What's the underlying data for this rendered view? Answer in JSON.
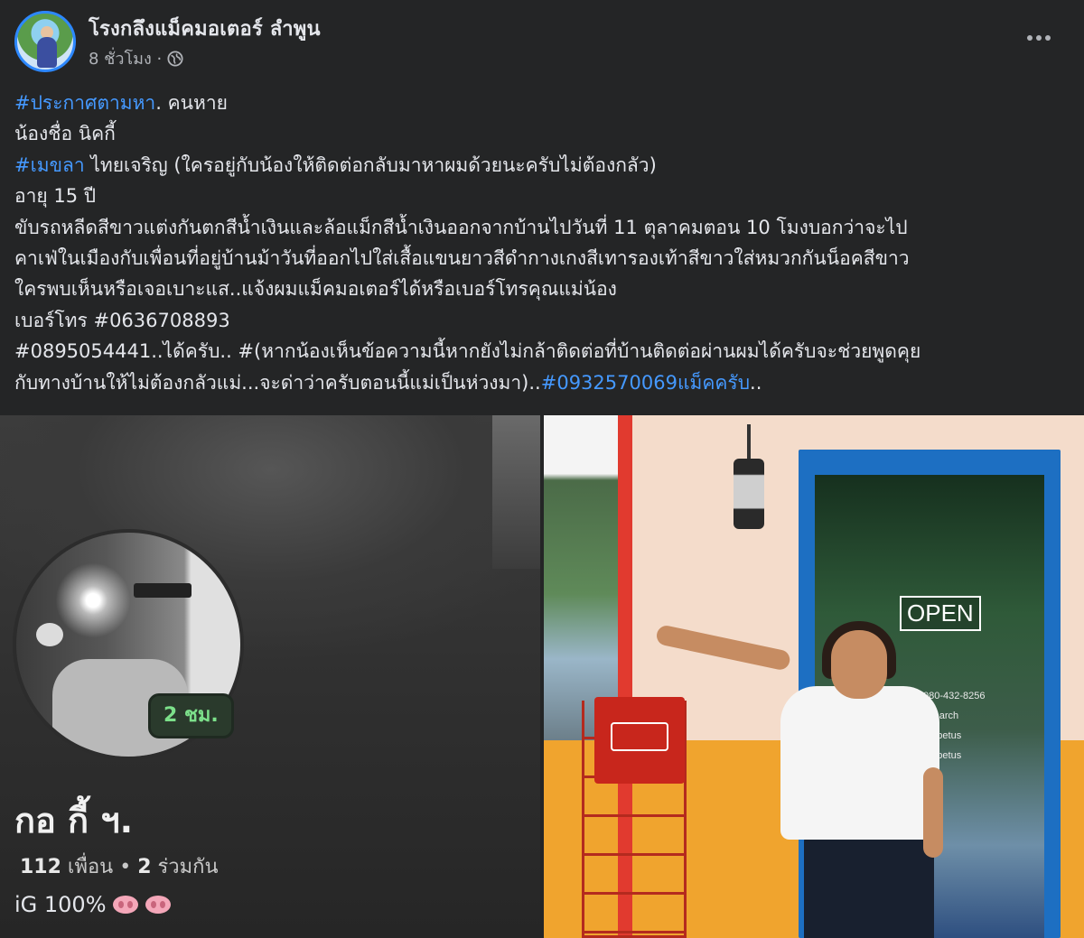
{
  "post": {
    "page_name": "โรงกลึงแม็คมอเตอร์ ลำพูน",
    "time": "8 ชั่วโมง · ",
    "privacy_icon": "globe-icon",
    "more_icon": "more-dots-icon"
  },
  "body": {
    "line1_hashtag": "#ประกาศตามหา",
    "line1_rest": ". คนหาย",
    "line2": "น้องชื่อ นิคกี้",
    "line3_hashtag": "#เมขลา",
    "line3_rest": " ไทยเจริญ (ใครอยู่กับน้องให้ติดต่อกลับมาหาผมด้วยนะครับไม่ต้องกลัว)",
    "line4": "อายุ 15 ปี",
    "line5": "ขับรถหลีดสีขาวแต่งกันตกสีน้ำเงินและล้อแม็กสีน้ำเงินออกจากบ้านไปวันที่ 11 ตุลาคมตอน 10 โมงบอกว่าจะไป",
    "line6": "คาเฟ่ในเมืองกับเพื่อนที่อยู่บ้านม้าวันที่ออกไปใส่เสื้อแขนยาวสีดำกางเกงสีเทารองเท้าสีขาวใส่หมวกกันน็อคสีขาว",
    "line7": "ใครพบเห็นหรือเจอเบาะแส..แจ้งผมแม็คมอเตอร์ได้หรือเบอร์โทรคุณแม่น้อง",
    "line8": "เบอร์โทร  #0636708893",
    "line9": " #0895054441..ได้ครับ.. #(หากน้องเห็นข้อความนี้หากยังไม่กล้าติดต่อที่บ้านติดต่อผ่านผมได้ครับจะช่วยพูดคุย",
    "line10_rest": "กับทางบ้านให้ไม่ต้องกลัวแม่...จะด่าว่าครับตอนนี้แม่เป็นห่วงมา)..",
    "line10_hashtag": "#0932570069แม็คครับ",
    "line10_tail": ".."
  },
  "left_image": {
    "time_badge": "2 ชม.",
    "profile_name": "กอ กี้ ฯ.",
    "friends_count": "112",
    "friends_label": " เพื่อน",
    "mutual_count": "2",
    "mutual_label": " ร่วมกัน",
    "separator": " • ",
    "bio": "iG 100%",
    "bio_icon": "pig-nose-emoji-icon"
  },
  "right_image": {
    "open_sign": "OPEN",
    "door_info": [
      "080-432-8256",
      "richarch",
      "crepetus",
      "crepetus"
    ]
  },
  "colors": {
    "background": "#242526",
    "text": "#e4e6eb",
    "secondary_text": "#b0b3b8",
    "hashtag": "#4599ff",
    "avatar_ring": "#2d88ff"
  }
}
